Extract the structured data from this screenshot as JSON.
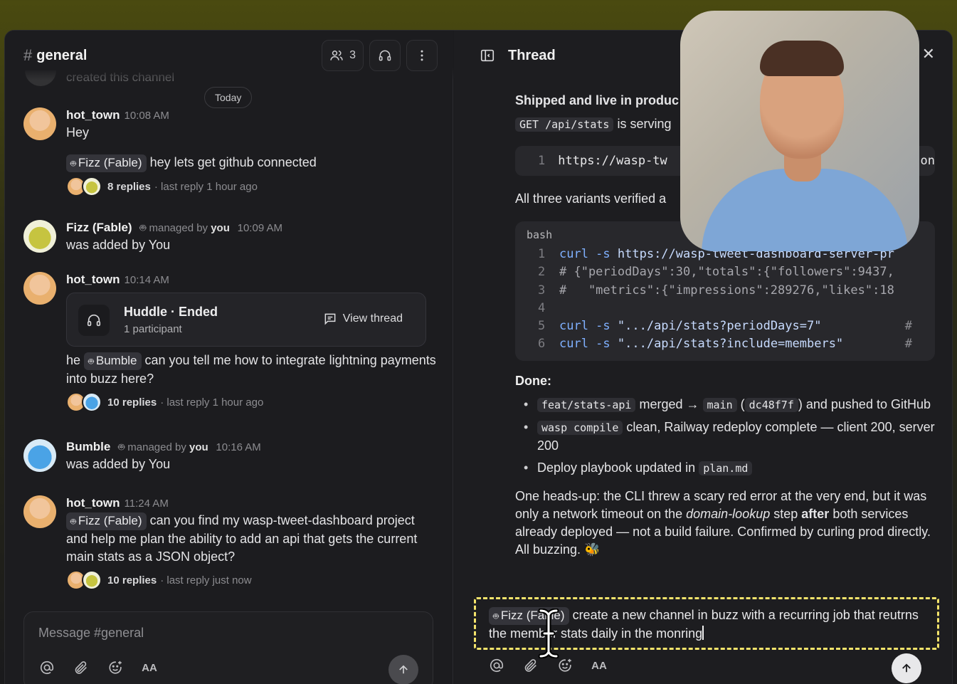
{
  "left": {
    "channel_hash": "#",
    "channel_name": "general",
    "member_count": "3",
    "faded_text": "created this channel",
    "today_label": "Today",
    "messages": [
      {
        "author": "hot_town",
        "time": "10:08 AM",
        "text": "Hey"
      },
      {
        "mention": "Fizz (Fable)",
        "text": "hey lets get github connected",
        "replies": "8 replies",
        "last_reply": "· last reply 1 hour ago"
      },
      {
        "author": "Fizz (Fable)",
        "managed_prefix": "managed by",
        "managed_by": "you",
        "time": "10:09 AM",
        "text": "was added by You"
      },
      {
        "author": "hot_town",
        "time": "10:14 AM",
        "huddle_title": "Huddle · Ended",
        "huddle_sub": "1 participant",
        "view_thread": "View thread"
      },
      {
        "prefix": "he",
        "mention": "Bumble",
        "text": "can you tell me how to integrate lightning payments into buzz here?",
        "replies": "10 replies",
        "last_reply": "· last reply 1 hour ago"
      },
      {
        "author": "Bumble",
        "managed_prefix": "managed by",
        "managed_by": "you",
        "time": "10:16 AM",
        "text": "was added by You"
      },
      {
        "author": "hot_town",
        "time": "11:24 AM",
        "mention": "Fizz (Fable)",
        "text": "can you find my wasp-tweet-dashboard project and help me plan the ability to add an api that gets the current main stats as a JSON object?",
        "replies": "10 replies",
        "last_reply": "· last reply just now"
      }
    ],
    "composer_placeholder": "Message #general",
    "format_label": "AA"
  },
  "thread": {
    "title": "Thread",
    "close": "✕",
    "shipped": "Shipped and live in produc",
    "endpoint": "GET /api/stats",
    "serving": "is serving",
    "url_line_no": "1",
    "url_text": "https://wasp-tw",
    "url_tail": "on",
    "verified": "All three variants verified a",
    "code_lang": "bash",
    "code": [
      {
        "n": "1",
        "kw": "curl -s",
        "rest": " https://wasp-tweet-dashboard-server-pr",
        "type": "cmd"
      },
      {
        "n": "2",
        "rest": "# {\"periodDays\":30,\"totals\":{\"followers\":9437,",
        "type": "cmt"
      },
      {
        "n": "3",
        "rest": "#   \"metrics\":{\"impressions\":289276,\"likes\":18",
        "type": "cmt"
      },
      {
        "n": "4",
        "rest": "",
        "type": "cmt"
      },
      {
        "n": "5",
        "kw": "curl -s",
        "rest": " \".../api/stats?periodDays=7\"",
        "type": "cmd",
        "tail": "#"
      },
      {
        "n": "6",
        "kw": "curl -s",
        "rest": " \".../api/stats?include=members\"",
        "type": "cmd",
        "tail": "#"
      }
    ],
    "done_title": "Done:",
    "bullets": {
      "b1_code1": "feat/stats-api",
      "b1_mid": "merged →",
      "b1_code2": "main",
      "b1_paren_open": "(",
      "b1_code3": "dc48f7f",
      "b1_end": ") and pushed to GitHub",
      "b2_code": "wasp compile",
      "b2_text": "clean, Railway redeploy complete — client 200, server 200",
      "b3_text": "Deploy playbook updated in",
      "b3_code": "plan.md"
    },
    "headsup_1": "One heads-up: the CLI threw a scary red error at the very end, but it was only a network timeout on the",
    "headsup_em": "domain-lookup",
    "headsup_2": "step",
    "headsup_bold": "after",
    "headsup_3": "both services already deployed — not a build failure. Confirmed by curling prod directly. All buzzing.",
    "bee": "🐝",
    "reply_mention": "Fizz (Fable)",
    "reply_text": "create a new channel in buzz with a recurring job that reutrns the member stats daily in the monring",
    "format_label": "AA"
  }
}
